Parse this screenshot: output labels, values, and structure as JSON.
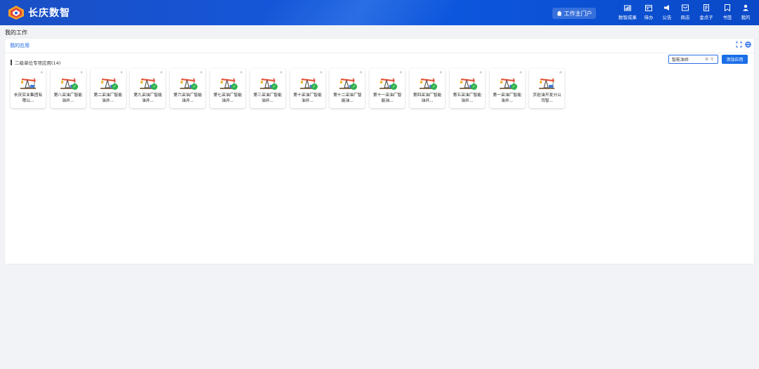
{
  "header": {
    "logo_text": "长庆数智",
    "portal_button": "工作主门户",
    "nav": [
      {
        "label": "数智成果",
        "icon": "chart-folder-icon"
      },
      {
        "label": "待办",
        "icon": "calendar-icon"
      },
      {
        "label": "公告",
        "icon": "megaphone-icon"
      },
      {
        "label": "商店",
        "icon": "store-icon"
      },
      {
        "label": "金点子",
        "icon": "idea-doc-icon"
      },
      {
        "label": "书签",
        "icon": "bookmark-icon"
      },
      {
        "label": "我的",
        "icon": "user-icon"
      }
    ]
  },
  "page_title": "我的工作",
  "card": {
    "title": "我的应用",
    "section_label": "二级单位专项应用(14)",
    "search": {
      "value": "智能油井"
    },
    "add_button": "添加应用"
  },
  "tiles": [
    {
      "name": "长庆实业集团有限公...",
      "checked": false
    },
    {
      "name": "第八采油厂智能油井...",
      "checked": true
    },
    {
      "name": "第二采油厂智能油井...",
      "checked": true
    },
    {
      "name": "第九采油厂智能油井...",
      "checked": true
    },
    {
      "name": "第六采油厂智能油井...",
      "checked": true
    },
    {
      "name": "第七采油厂智能油井...",
      "checked": true
    },
    {
      "name": "第三采油厂智能油井...",
      "checked": true
    },
    {
      "name": "第十采油厂智能油井...",
      "checked": true
    },
    {
      "name": "第十二采油厂智能油...",
      "checked": true
    },
    {
      "name": "第十一采油厂智能油...",
      "checked": true
    },
    {
      "name": "第四采油厂智能油井...",
      "checked": true
    },
    {
      "name": "第五采油厂智能油井...",
      "checked": true
    },
    {
      "name": "第一采油厂智能油井...",
      "checked": true
    },
    {
      "name": "页岩油开发分公司智...",
      "checked": false
    }
  ]
}
